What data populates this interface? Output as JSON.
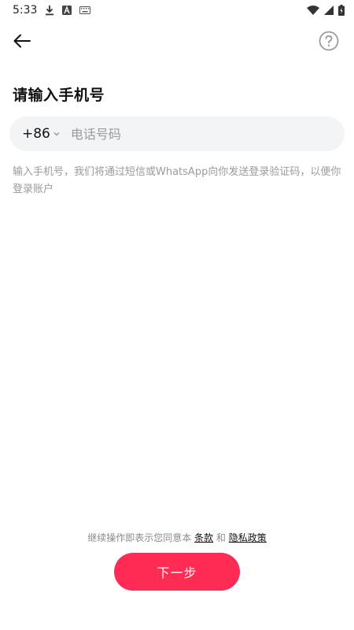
{
  "status_bar": {
    "time": "5:33",
    "icons": [
      "download-icon",
      "a-icon",
      "keyboard-icon",
      "wifi-icon",
      "signal-icon",
      "battery-icon"
    ]
  },
  "nav": {
    "back_icon": "arrow-left-icon",
    "help_icon": "question-circle-icon"
  },
  "title": "请输入手机号",
  "phone": {
    "country_code": "+86",
    "placeholder": "电话号码",
    "value": ""
  },
  "hint": "输入手机号，我们将通过短信或WhatsApp向你发送登录验证码，以便你登录账户",
  "terms": {
    "prefix": "继续操作即表示您同意本",
    "terms_link": "条款",
    "and": "和",
    "privacy_link": "隐私政策"
  },
  "next_button": {
    "label": "下一步"
  },
  "colors": {
    "accent": "#fe2c55",
    "input_bg": "#f3f4f6",
    "hint_text": "#9a9aa0"
  }
}
